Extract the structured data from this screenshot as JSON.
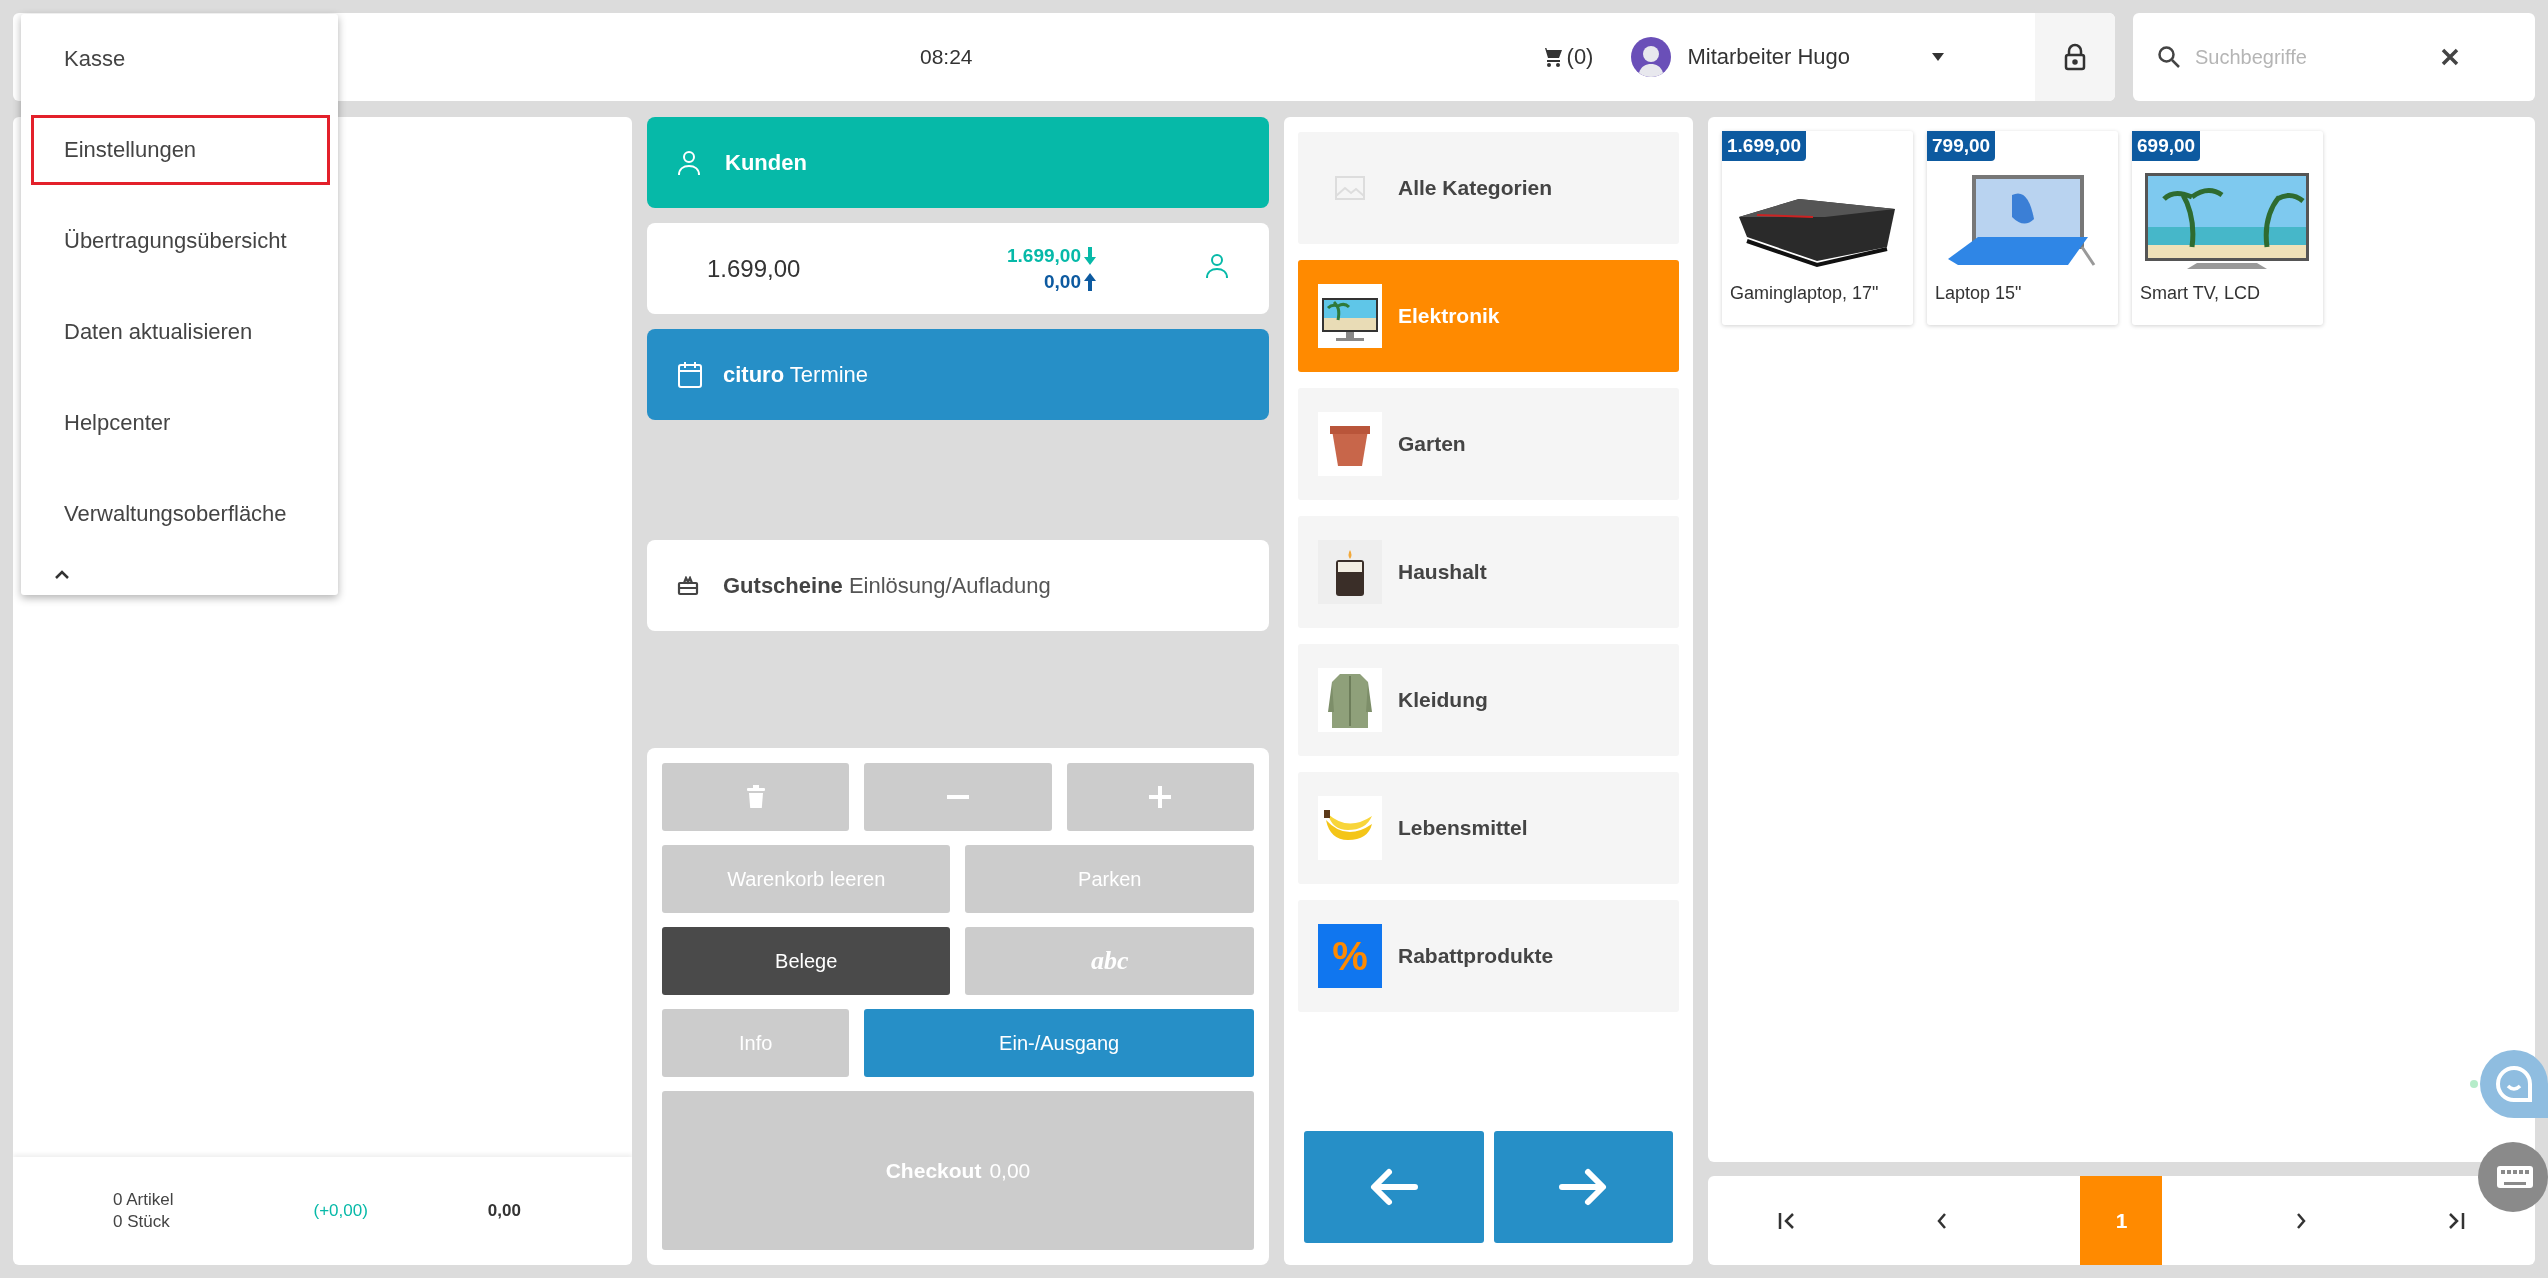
{
  "menu": {
    "items": [
      {
        "label": "Kasse",
        "selected": false
      },
      {
        "label": "Einstellungen",
        "selected": true
      },
      {
        "label": "Übertragungsübersicht",
        "selected": false
      },
      {
        "label": "Daten aktualisieren",
        "selected": false
      },
      {
        "label": "Helpcenter",
        "selected": false
      },
      {
        "label": "Verwaltungsoberfläche",
        "selected": false
      }
    ]
  },
  "topbar": {
    "time": "08:24",
    "cart_count": "(0)",
    "user": "Mitarbeiter Hugo"
  },
  "search": {
    "placeholder": "Suchbegriffe"
  },
  "cart": {
    "articles": "0 Artikel",
    "pieces": "0 Stück",
    "change": "(+0,00)",
    "total": "0,00"
  },
  "customer": {
    "label": "Kunden"
  },
  "balance": {
    "total": "1.699,00",
    "incoming": "1.699,00",
    "outgoing": "0,00"
  },
  "appointments": {
    "label": "**cituro** Termine"
  },
  "vouchers": {
    "label": "**Gutscheine** Einlösung/Aufladung"
  },
  "keypad": {
    "buttons": [
      {
        "label": "Warenkorb leeren",
        "kind": "grey"
      },
      {
        "label": "Parken",
        "kind": "grey"
      },
      {
        "label": "Belege",
        "kind": "dark"
      },
      {
        "label": "abc",
        "kind": "script"
      },
      {
        "label": "Info",
        "kind": "grey"
      },
      {
        "label": "Ein-/Ausgang",
        "kind": "blue"
      }
    ],
    "checkout": {
      "label": "Checkout",
      "amount": "0,00"
    }
  },
  "categories": [
    {
      "label": "Alle Kategorien",
      "selected": false
    },
    {
      "label": "Elektronik",
      "selected": true
    },
    {
      "label": "Garten",
      "selected": false
    },
    {
      "label": "Haushalt",
      "selected": false
    },
    {
      "label": "Kleidung",
      "selected": false
    },
    {
      "label": "Lebensmittel",
      "selected": false
    },
    {
      "label": "Rabattprodukte",
      "selected": false,
      "badge": "%"
    }
  ],
  "products": [
    {
      "name": "Gaminglaptop, 17\"",
      "price": "1.699,00"
    },
    {
      "name": "Laptop 15\"",
      "price": "799,00"
    },
    {
      "name": "Smart TV, LCD",
      "price": "699,00"
    }
  ],
  "pagination": {
    "pages": [
      {
        "label": "1",
        "selected": true
      }
    ]
  }
}
